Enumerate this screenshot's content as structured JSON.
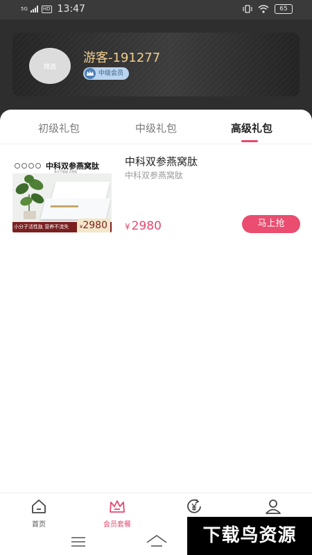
{
  "status_bar": {
    "signal_label": "5G",
    "hd_label": "HD",
    "time": "13:47",
    "battery": "65"
  },
  "profile": {
    "avatar_text": "精选",
    "username": "游客-191277",
    "level": "中级会员"
  },
  "tabs": [
    {
      "label": "初级礼包",
      "active": false
    },
    {
      "label": "中级礼包",
      "active": false
    },
    {
      "label": "高级礼包",
      "active": true
    }
  ],
  "product": {
    "image": {
      "title": "中科双参燕窝肽",
      "subtitle": "多分子肽链 活性肽",
      "banner": "小分子活性肽 营养不流失",
      "price_symbol": "¥",
      "price": "2980"
    },
    "name": "中科双参燕窝肽",
    "subtitle": "中科双参燕窝肽",
    "price_symbol": "¥",
    "price": "2980",
    "buy_label": "马上抢"
  },
  "bottom_nav": [
    {
      "label": "首页",
      "icon": "home-icon",
      "active": false
    },
    {
      "label": "会员套餐",
      "icon": "crown-icon",
      "active": true
    },
    {
      "label": "品",
      "icon": "yuan-coin-icon",
      "active": false
    },
    {
      "label": "",
      "icon": "user-icon",
      "active": false
    }
  ],
  "watermark": "下载鸟资源",
  "colors": {
    "accent": "#e5486e",
    "header_bg": "#2e2e2e",
    "username_gold": "#f2cf8f",
    "badge_blue": "#b9d4ef"
  }
}
